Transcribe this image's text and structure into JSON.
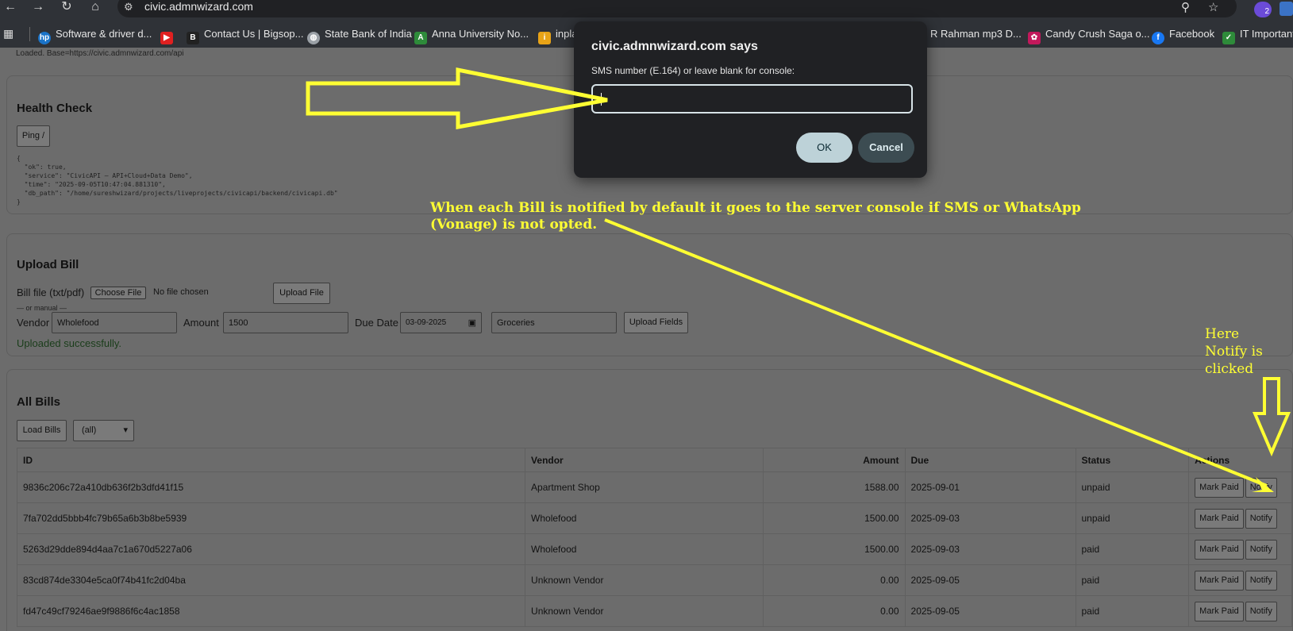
{
  "browser": {
    "url": "civic.admnwizard.com",
    "extension_badge": "2",
    "bookmarks": [
      "Software & driver d...",
      "Contact Us | Bigsop...",
      "State Bank of India",
      "Anna University No...",
      "inpla",
      "R Rahman mp3 D...",
      "Candy Crush Saga o...",
      "Facebook",
      "IT Important"
    ]
  },
  "page": {
    "loaded_text": "Loaded. Base=https://civic.admnwizard.com/api",
    "health": {
      "title": "Health Check",
      "ping_label": "Ping /",
      "response": "{\n  \"ok\": true,\n  \"service\": \"CivicAPI – API+Cloud+Data Demo\",\n  \"time\": \"2025-09-05T10:47:04.881310\",\n  \"db_path\": \"/home/sureshwizard/projects/liveprojects/civicapi/backend/civicapi.db\"\n}"
    },
    "upload": {
      "title": "Upload Bill",
      "file_label": "Bill file (txt/pdf)",
      "choose_label": "Choose File",
      "no_file": "No file chosen",
      "upload_file_label": "Upload File",
      "or_manual": "— or manual —",
      "vendor_label": "Vendor",
      "vendor_value": "Wholefood",
      "amount_label": "Amount",
      "amount_value": "1500",
      "due_label": "Due Date",
      "due_value": "03-09-2025",
      "category_value": "Groceries",
      "upload_fields_label": "Upload Fields",
      "success": "Uploaded successfully."
    },
    "bills": {
      "title": "All Bills",
      "load_label": "Load Bills",
      "filter_value": "(all)",
      "columns": [
        "ID",
        "Vendor",
        "Amount",
        "Due",
        "Status",
        "Actions"
      ],
      "mark_paid_label": "Mark Paid",
      "notify_label": "Notify",
      "rows": [
        {
          "id": "9836c206c72a410db636f2b3dfd41f15",
          "vendor": "Apartment Shop",
          "amount": "1588.00",
          "due": "2025-09-01",
          "status": "unpaid"
        },
        {
          "id": "7fa702dd5bbb4fc79b65a6b3b8be5939",
          "vendor": "Wholefood",
          "amount": "1500.00",
          "due": "2025-09-03",
          "status": "unpaid"
        },
        {
          "id": "5263d29dde894d4aa7c1a670d5227a06",
          "vendor": "Wholefood",
          "amount": "1500.00",
          "due": "2025-09-03",
          "status": "paid"
        },
        {
          "id": "83cd874de3304e5ca0f74b41fc2d04ba",
          "vendor": "Unknown Vendor",
          "amount": "0.00",
          "due": "2025-09-05",
          "status": "paid"
        },
        {
          "id": "fd47c49cf79246ae9f9886f6c4ac1858",
          "vendor": "Unknown Vendor",
          "amount": "0.00",
          "due": "2025-09-05",
          "status": "paid"
        }
      ]
    }
  },
  "dialog": {
    "title": "civic.admnwizard.com says",
    "message": "SMS number (E.164) or leave blank for console:",
    "input_value": "",
    "ok_label": "OK",
    "cancel_label": "Cancel"
  },
  "annotations": {
    "note_line1": "When each Bill is notified by default it goes to the server console if SMS or WhatsApp",
    "note_line2": "(Vonage) is not opted.",
    "here_line1": "Here",
    "here_line2": "Notify is",
    "here_line3": "clicked",
    "color": "#ffff33"
  }
}
